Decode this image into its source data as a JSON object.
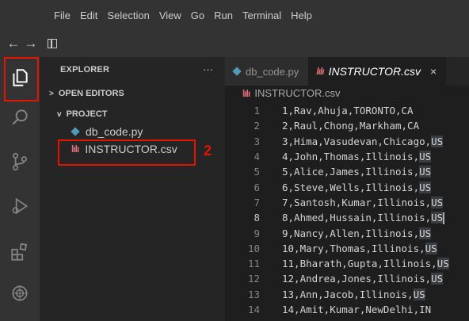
{
  "menu": [
    "File",
    "Edit",
    "Selection",
    "View",
    "Go",
    "Run",
    "Terminal",
    "Help"
  ],
  "nav": {
    "back": "←",
    "forward": "→"
  },
  "explorer": {
    "title": "EXPLORER",
    "more": "···",
    "open_editors": "OPEN EDITORS",
    "project": "PROJECT",
    "files": [
      "db_code.py",
      "INSTRUCTOR.csv"
    ]
  },
  "annotations": {
    "one": "1",
    "two": "2",
    "box_color": "#e51400"
  },
  "tabs": [
    {
      "label": "db_code.py",
      "icon": "python-icon"
    },
    {
      "label": "INSTRUCTOR.csv",
      "icon": "csv-icon",
      "active": true,
      "close": "×"
    }
  ],
  "breadcrumb": "INSTRUCTOR.csv",
  "csv_icon_glyph": "lılı",
  "code_lines": [
    {
      "n": "1",
      "text": "1,Rav,Ahuja,TORONTO,CA"
    },
    {
      "n": "2",
      "text": "2,Raul,Chong,Markham,CA"
    },
    {
      "n": "3",
      "text": "3,Hima,Vasudevan,Chicago,",
      "hl": "US"
    },
    {
      "n": "4",
      "text": "4,John,Thomas,Illinois,",
      "hl": "US"
    },
    {
      "n": "5",
      "text": "5,Alice,James,Illinois,",
      "hl": "US"
    },
    {
      "n": "6",
      "text": "6,Steve,Wells,Illinois,",
      "hl": "US"
    },
    {
      "n": "7",
      "text": "7,Santosh,Kumar,Illinois,",
      "hl": "US"
    },
    {
      "n": "8",
      "text": "8,Ahmed,Hussain,Illinois,",
      "hl": "US",
      "cursor": true
    },
    {
      "n": "9",
      "text": "9,Nancy,Allen,Illinois,",
      "hl": "US"
    },
    {
      "n": "10",
      "text": "10,Mary,Thomas,Illinois,",
      "hl": "US"
    },
    {
      "n": "11",
      "text": "11,Bharath,Gupta,Illinois,",
      "hl": "US"
    },
    {
      "n": "12",
      "text": "12,Andrea,Jones,Illinois,",
      "hl": "US"
    },
    {
      "n": "13",
      "text": "13,Ann,Jacob,Illinois,",
      "hl": "US"
    },
    {
      "n": "14",
      "text": "14,Amit,Kumar,NewDelhi,IN"
    }
  ],
  "colors": {
    "python": "#519aba",
    "csv": "#e06c75",
    "selection": "#3a3d41"
  }
}
